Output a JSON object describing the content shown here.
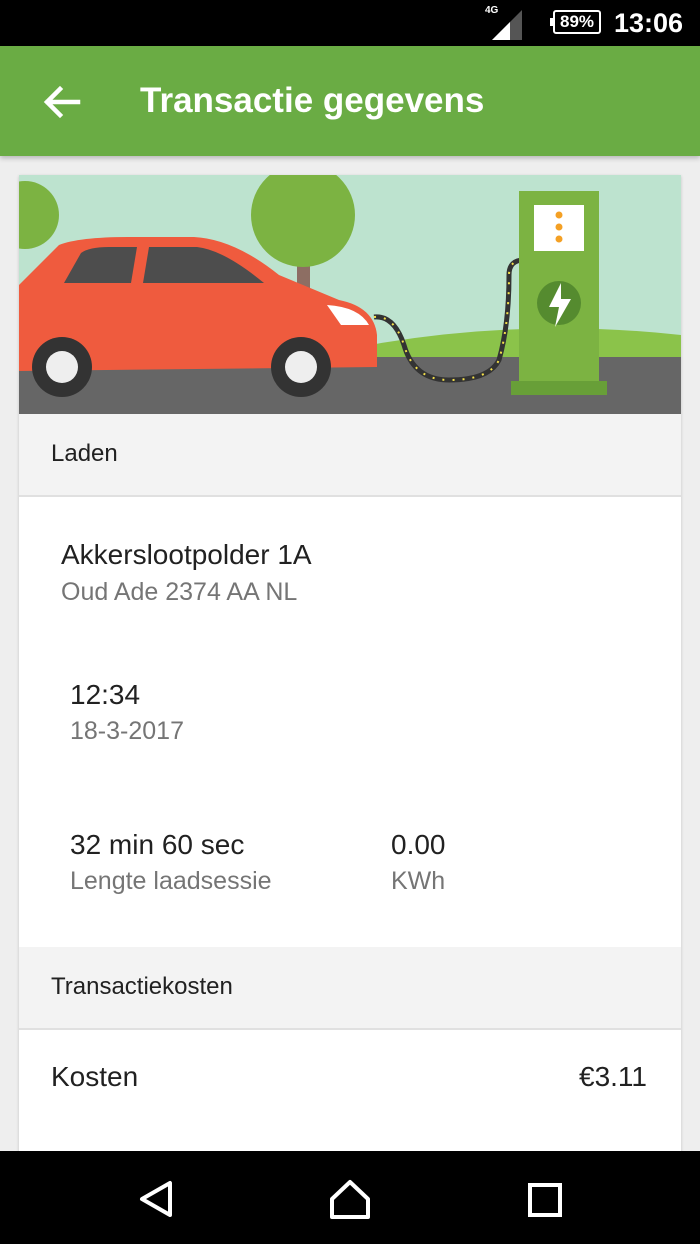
{
  "status_bar": {
    "network": "4G",
    "battery": "89%",
    "time": "13:06"
  },
  "app_bar": {
    "title": "Transactie gegevens",
    "back_icon": "arrow-back-icon"
  },
  "charging": {
    "section_title": "Laden",
    "station_name": "Akkerslootpolder 1A",
    "station_address": "Oud Ade 2374 AA NL",
    "start_time": "12:34",
    "start_date": "18-3-2017",
    "duration_value": "32 min 60 sec",
    "duration_label": "Lengte laadsessie",
    "energy_value": "0.00",
    "energy_label": "KWh"
  },
  "costs": {
    "section_title": "Transactiekosten",
    "label": "Kosten",
    "value": "€3.11"
  },
  "nav": {
    "back_icon": "triangle-back-icon",
    "home_icon": "home-icon",
    "recents_icon": "square-recents-icon"
  },
  "colors": {
    "primary": "#6aac44",
    "car": "#ef5b3e",
    "charger": "#7cb342",
    "sky": "#bde3cf"
  }
}
